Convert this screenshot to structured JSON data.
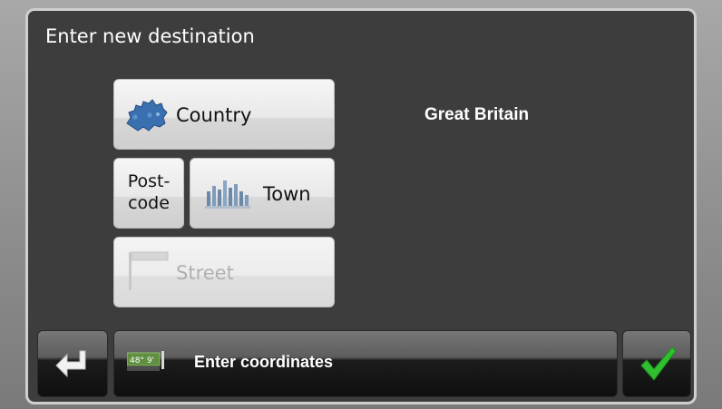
{
  "dialog": {
    "title": "Enter new destination"
  },
  "buttons": {
    "country": {
      "label": "Country",
      "icon": "europe-map-icon"
    },
    "postcode": {
      "label": "Post-\ncode"
    },
    "town": {
      "label": "Town",
      "icon": "town-skyline-icon"
    },
    "street": {
      "label": "Street",
      "icon": "street-sign-icon",
      "disabled": true
    }
  },
  "selection": {
    "country_value": "Great Britain"
  },
  "bottom_bar": {
    "back_icon": "back-arrow-icon",
    "coords_label": "Enter coordinates",
    "coords_icon": "coordinates-icon",
    "coords_icon_text": "48° 9'",
    "confirm_icon": "checkmark-icon"
  },
  "colors": {
    "background": "#3d3d3d",
    "accent_green": "#2fbf2f",
    "disabled_text": "#b0b0b0"
  }
}
